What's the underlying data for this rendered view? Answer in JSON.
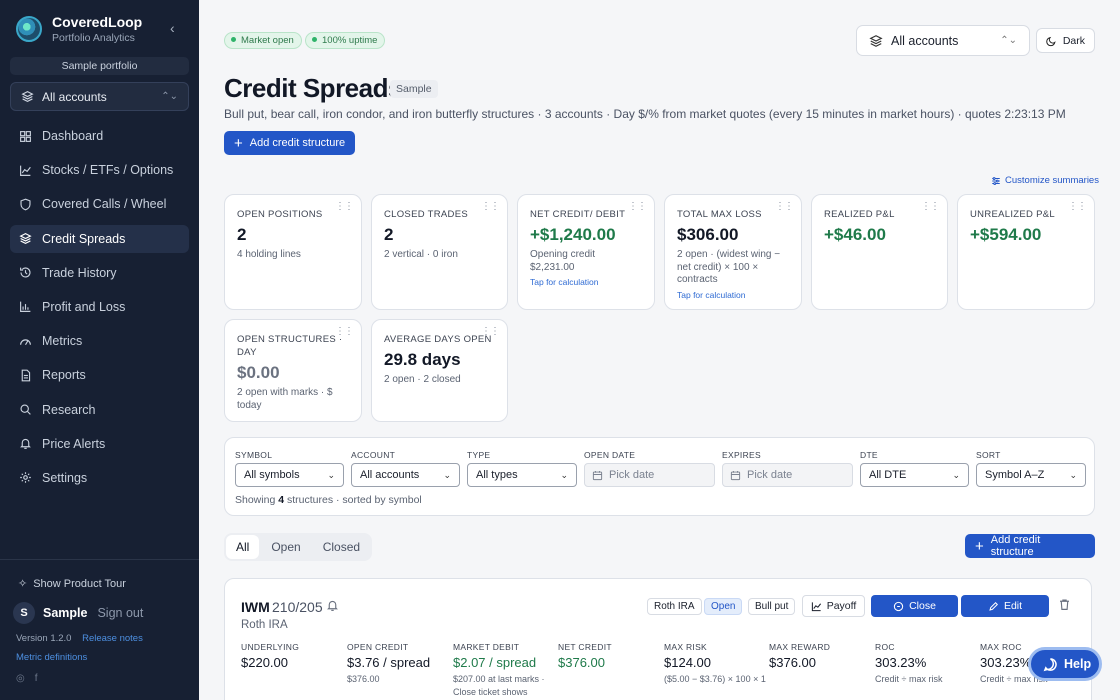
{
  "app": {
    "name": "CoveredLoop",
    "tagline": "Portfolio Analytics"
  },
  "sidebar": {
    "sample_label": "Sample portfolio",
    "account_select": "All accounts",
    "items": [
      {
        "label": "Dashboard",
        "icon": "dashboard-icon"
      },
      {
        "label": "Stocks / ETFs / Options",
        "icon": "chart-line-icon"
      },
      {
        "label": "Covered Calls / Wheel",
        "icon": "shield-icon"
      },
      {
        "label": "Credit Spreads",
        "icon": "layers-icon",
        "active": true
      },
      {
        "label": "Trade History",
        "icon": "history-icon"
      },
      {
        "label": "Profit and Loss",
        "icon": "bar-chart-icon"
      },
      {
        "label": "Metrics",
        "icon": "gauge-icon"
      },
      {
        "label": "Reports",
        "icon": "document-icon"
      },
      {
        "label": "Research",
        "icon": "search-icon"
      },
      {
        "label": "Price Alerts",
        "icon": "bell-icon"
      },
      {
        "label": "Settings",
        "icon": "gear-icon"
      }
    ],
    "tour": "Show Product Tour",
    "user_initial": "S",
    "user_name": "Sample",
    "sign_out": "Sign out",
    "version": "Version 1.2.0",
    "release_notes": "Release notes",
    "metric_definitions": "Metric definitions"
  },
  "header": {
    "market_status": "Market open",
    "uptime": "100% uptime",
    "account_select": "All accounts",
    "theme_button": "Dark",
    "title": "Credit Spreads",
    "title_tag": "Sample",
    "subtitle": "Bull put, bear call, iron condor, and iron butterfly structures · 3 accounts · Day $/% from market quotes (every 15 minutes in market hours) · quotes 2:23:13 PM",
    "add_button": "Add credit structure",
    "customize": "Customize summaries"
  },
  "cards": [
    {
      "label": "Open positions",
      "value": "2",
      "sub": "4 holding lines"
    },
    {
      "label": "Closed trades",
      "value": "2",
      "sub": "2 vertical · 0 iron"
    },
    {
      "label": "Net credit/ debit",
      "value": "+$1,240.00",
      "sub": "Opening credit $2,231.00",
      "tap": "Tap for calculation"
    },
    {
      "label": "Total max loss",
      "value": "$306.00",
      "sub": "2 open · (widest wing − net credit) × 100 × contracts",
      "tap": "Tap for calculation"
    },
    {
      "label": "Realized P&L",
      "value": "+$46.00"
    },
    {
      "label": "Unrealized P&L",
      "value": "+$594.00"
    },
    {
      "label": "Open structures · Day",
      "value": "$0.00",
      "sub": "2 open with marks · $ today"
    },
    {
      "label": "Average days open",
      "value": "29.8 days",
      "sub": "2 open · 2 closed"
    }
  ],
  "filters": {
    "symbol": {
      "label": "Symbol",
      "value": "All symbols"
    },
    "account": {
      "label": "Account",
      "value": "All accounts"
    },
    "type": {
      "label": "Type",
      "value": "All types"
    },
    "open_date": {
      "label": "Open date",
      "placeholder": "Pick date"
    },
    "expires": {
      "label": "Expires",
      "placeholder": "Pick date"
    },
    "dte": {
      "label": "DTE",
      "value": "All DTE"
    },
    "sort": {
      "label": "Sort",
      "value": "Symbol A–Z"
    },
    "showing_prefix": "Showing",
    "showing_count": "4",
    "showing_suffix": "structures · sorted by symbol"
  },
  "segments": [
    "All",
    "Open",
    "Closed"
  ],
  "list_add_button": "Add credit structure",
  "trade": {
    "symbol": "IWM",
    "strikes": "210/205",
    "account": "Roth IRA",
    "tags": {
      "account": "Roth IRA",
      "status": "Open",
      "type": "Bull put"
    },
    "buttons": {
      "payoff": "Payoff",
      "close": "Close",
      "edit": "Edit"
    },
    "columns": [
      {
        "h": "Underlying",
        "v": "$220.00",
        "s": ""
      },
      {
        "h": "Open credit",
        "v": "$3.76 / spread",
        "s": "$376.00"
      },
      {
        "h": "Market debit",
        "v": "$2.07 / spread",
        "s": "$207.00 at last marks · Close ticket shows"
      },
      {
        "h": "Net credit",
        "v": "$376.00",
        "s": ""
      },
      {
        "h": "Max risk",
        "v": "$124.00",
        "s": "($5.00 − $3.76) × 100 × 1"
      },
      {
        "h": "Max reward",
        "v": "$376.00",
        "s": ""
      },
      {
        "h": "ROC",
        "v": "303.23%",
        "s": "Credit ÷ max risk"
      },
      {
        "h": "Max ROC",
        "v": "303.23%",
        "s": "Credit ÷ max risk"
      }
    ]
  },
  "help_button": "Help",
  "colors": {
    "sidebar_bg": "#172033",
    "accent": "#2356c7",
    "positive": "#1f7a4a"
  }
}
